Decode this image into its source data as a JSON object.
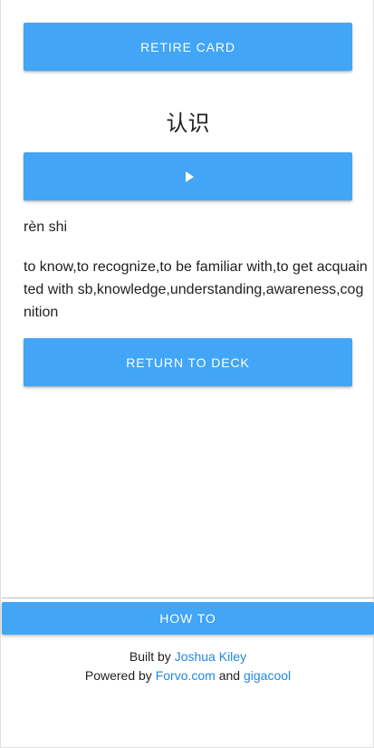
{
  "card": {
    "retire_label": "RETIRE CARD",
    "hanzi": "认识",
    "pinyin": "rèn shi",
    "definition": "to know,to recognize,to be familiar with,to get acquainted with sb,knowledge,understanding,awareness,cognition",
    "return_label": "RETURN TO DECK"
  },
  "footer": {
    "howto_label": "HOW TO",
    "built_by_prefix": "Built by",
    "author": "Joshua Kiley",
    "powered_by_prefix": "Powered by",
    "forvo": "Forvo.com",
    "and": "and",
    "gigacool": "gigacool"
  },
  "colors": {
    "accent": "#42a5f5",
    "link": "#1e88e5"
  },
  "icons": {
    "play": "play-icon"
  }
}
